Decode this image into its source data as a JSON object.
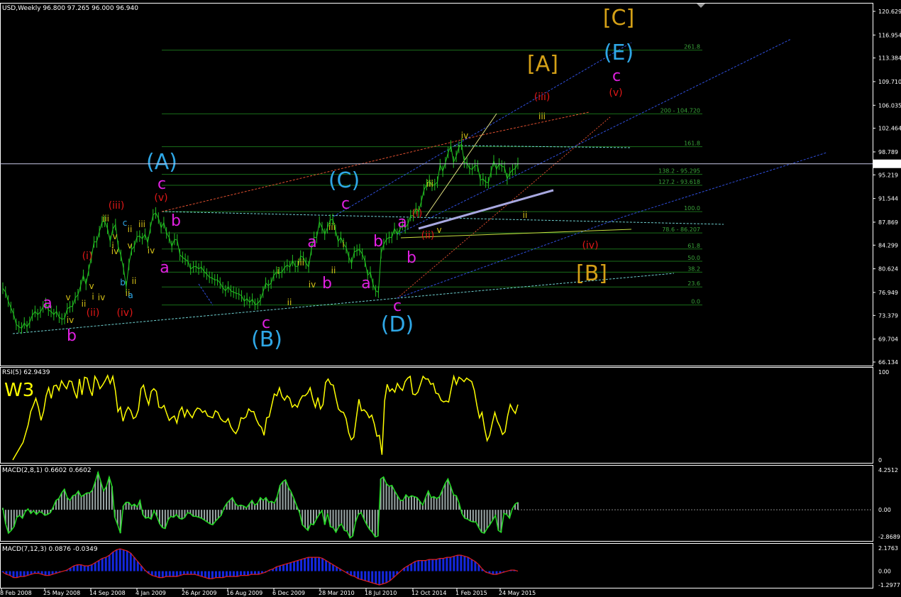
{
  "chart_data": {
    "type": "line",
    "symbol_title": "USD,Weekly  96.800 97.265 96.000 96.940",
    "current_price_label": "96.940",
    "y_ticks": [
      "120.629",
      "116.954",
      "113.384",
      "109.710",
      "106.035",
      "102.464",
      "98.789",
      "95.219",
      "91.544",
      "87.869",
      "84.299",
      "80.624",
      "76.949",
      "73.379",
      "69.704",
      "66.134"
    ],
    "x_ticks": [
      "8 Feb 2008",
      "25 May 2008",
      "14 Sep 2008",
      "4 Jan 2009",
      "26 Apr 2009",
      "16 Aug 2009",
      "6 Dec 2009",
      "28 Mar 2010",
      "18 Jul 2010",
      "12 Oct 2014",
      "1 Feb 2015",
      "24 May 2015"
    ],
    "price": [
      77.6,
      77.0,
      75.6,
      74.6,
      73.6,
      72.0,
      71.6,
      71.4,
      72.2,
      71.6,
      72.3,
      73.4,
      74.0,
      73.5,
      73.9,
      74.7,
      75.2,
      74.2,
      74.0,
      73.5,
      74.0,
      73.1,
      72.8,
      72.9,
      74.4,
      74.7,
      74.8,
      76.1,
      76.6,
      78.0,
      79.6,
      78.2,
      80.4,
      82.4,
      84.8,
      84.8,
      86.4,
      87.9,
      88.0,
      86.9,
      84.9,
      86.8,
      87.5,
      84.1,
      82.7,
      80.6,
      77.8,
      81.3,
      83.6,
      84.1,
      85.6,
      85.7,
      85.3,
      86.0,
      84.7,
      87.0,
      89.0,
      89.3,
      88.5,
      87.0,
      87.8,
      86.2,
      85.5,
      84.1,
      85.2,
      85.1,
      82.8,
      82.4,
      82.1,
      81.8,
      80.6,
      80.9,
      81.0,
      80.6,
      80.9,
      80.2,
      79.8,
      79.3,
      79.2,
      78.9,
      78.9,
      78.4,
      77.7,
      77.2,
      77.8,
      77.2,
      77.0,
      76.8,
      76.7,
      76.4,
      75.6,
      76.0,
      75.4,
      75.9,
      75.1,
      75.2,
      75.8,
      77.0,
      78.4,
      78.0,
      78.4,
      79.6,
      80.1,
      80.0,
      80.1,
      80.8,
      81.2,
      80.9,
      81.9,
      81.0,
      81.0,
      82.6,
      82.4,
      81.5,
      80.9,
      83.6,
      85.5,
      85.5,
      87.9,
      87.0,
      86.0,
      87.0,
      88.2,
      88.3,
      86.6,
      84.9,
      85.5,
      84.5,
      83.9,
      82.4,
      81.5,
      83.2,
      83.5,
      83.6,
      82.9,
      81.8,
      79.6,
      80.1,
      78.2,
      77.2,
      77.0,
      83.1,
      84.4,
      85.2,
      85.5,
      85.5,
      86.9,
      86.0,
      86.7,
      87.5,
      87.0,
      87.6,
      88.9,
      88.9,
      90.0,
      89.5,
      91.1,
      92.9,
      93.7,
      94.3,
      93.6,
      93.7,
      94.1,
      96.8,
      95.8,
      97.1,
      98.7,
      99.7,
      97.2,
      98.1,
      99.5,
      100.0,
      97.2,
      97.1,
      96.2,
      96.1,
      96.7,
      96.6,
      94.4,
      94.6,
      94.1,
      94.0,
      95.7,
      97.4,
      96.1,
      96.9,
      96.6,
      96.4,
      94.6,
      95.5,
      96.0,
      96.2,
      97.0
    ],
    "rsi": {
      "title": "RSI(5) 62.9439",
      "label": "W3",
      "y_ticks": [
        "100",
        "0"
      ],
      "values": [
        0,
        5,
        10,
        15,
        20,
        30,
        40,
        55,
        62,
        70,
        60,
        45,
        55,
        73,
        82,
        70,
        84,
        85,
        79,
        90,
        85,
        81,
        90,
        89,
        78,
        70,
        92,
        74,
        94,
        93,
        81,
        73,
        95,
        90,
        81,
        85,
        90,
        96,
        87,
        95,
        79,
        55,
        60,
        44,
        54,
        60,
        56,
        47,
        49,
        57,
        81,
        85,
        72,
        63,
        78,
        81,
        78,
        60,
        59,
        62,
        53,
        45,
        48,
        50,
        42,
        55,
        60,
        49,
        57,
        52,
        48,
        55,
        59,
        58,
        54,
        56,
        50,
        49,
        48,
        56,
        54,
        47,
        44,
        43,
        47,
        38,
        33,
        30,
        36,
        48,
        47,
        49,
        58,
        55,
        55,
        46,
        40,
        37,
        28,
        48,
        49,
        62,
        75,
        73,
        82,
        72,
        68,
        73,
        70,
        60,
        63,
        60,
        68,
        73,
        73,
        76,
        82,
        69,
        60,
        71,
        58,
        63,
        88,
        92,
        86,
        85,
        71,
        58,
        55,
        54,
        47,
        31,
        23,
        26,
        48,
        69,
        56,
        57,
        54,
        48,
        51,
        41,
        27,
        28,
        6,
        67,
        86,
        78,
        81,
        77,
        87,
        82,
        79,
        89,
        93,
        95,
        75,
        74,
        77,
        86,
        95,
        92,
        92,
        86,
        87,
        76,
        75,
        68,
        66,
        67,
        66,
        81,
        95,
        86,
        94,
        92,
        89,
        93,
        91,
        89,
        79,
        62,
        48,
        54,
        36,
        22,
        28,
        42,
        54,
        44,
        38,
        29,
        32,
        50,
        63,
        57,
        53,
        63
      ]
    },
    "macd1": {
      "title": "MACD(2,8,1) 0.6602 0.6602",
      "y_ticks": [
        "4.2512",
        "0.00",
        "-2.8689"
      ],
      "values": [
        0.2,
        -1.5,
        -2.5,
        -2.2,
        -1.8,
        -0.8,
        -0.6,
        -0.9,
        -0.2,
        0.1,
        -0.4,
        -0.1,
        -0.5,
        -0.2,
        -0.3,
        -0.6,
        -0.5,
        -0.3,
        0.3,
        1.0,
        1.2,
        1.8,
        2.2,
        1.3,
        1.0,
        1.5,
        1.6,
        2.0,
        1.4,
        1.6,
        1.8,
        1.8,
        2.1,
        3.0,
        4.0,
        3.0,
        2.0,
        2.5,
        3.5,
        2.5,
        -0.8,
        -1.6,
        -2.5,
        0.4,
        0.8,
        0.8,
        0.4,
        0.6,
        0.3,
        1.0,
        -0.5,
        -0.9,
        -0.8,
        -1.0,
        -0.1,
        -0.7,
        -1.5,
        -1.9,
        -2.0,
        -1.1,
        -0.7,
        -0.8,
        -0.5,
        -0.9,
        -1.0,
        -0.8,
        -0.3,
        -0.4,
        -0.7,
        -0.7,
        -0.8,
        -0.9,
        -1.1,
        -1.3,
        -1.5,
        -1.6,
        -1.2,
        -0.9,
        -0.6,
        0.2,
        0.7,
        1.0,
        1.3,
        0.7,
        0.4,
        0.5,
        0.4,
        0.2,
        0.6,
        1.0,
        0.5,
        0.7,
        1.3,
        1.0,
        1.3,
        0.8,
        0.9,
        0.7,
        1.4,
        2.6,
        3.0,
        3.2,
        2.4,
        1.9,
        1.2,
        0.4,
        -0.3,
        -1.6,
        -1.9,
        -2.2,
        -1.5,
        -1.6,
        -1.0,
        -0.5,
        -0.1,
        -1.6,
        -0.4,
        -1.8,
        -1.9,
        -2.4,
        -1.8,
        -1.5,
        -2.2,
        -2.3,
        -3.0,
        -2.8,
        -1.3,
        -0.5,
        -0.3,
        -1.0,
        -1.6,
        -2.1,
        -2.4,
        -2.9,
        -2.8,
        3.3,
        3.5,
        2.8,
        2.5,
        2.6,
        2.0,
        1.5,
        1.0,
        1.0,
        1.6,
        1.3,
        1.5,
        1.4,
        1.3,
        0.9,
        0.5,
        1.3,
        2.0,
        1.3,
        1.4,
        1.2,
        1.4,
        2.1,
        2.8,
        3.3,
        2.5,
        1.6,
        1.5,
        0.7,
        -0.4,
        -0.9,
        -1.0,
        -1.2,
        -1.3,
        -1.3,
        -1.9,
        -2.4,
        -2.5,
        -2.0,
        -1.6,
        -1.1,
        -0.6,
        -2.2,
        -2.4,
        -0.4,
        -0.5,
        -0.9,
        0.1,
        0.6,
        0.8
      ]
    },
    "macd2": {
      "title": "MACD(7,12,3) 0.0876 -0.0349",
      "y_ticks": [
        "2.1763",
        "0.00",
        "-1.2977"
      ],
      "values": [
        -0.1,
        -0.3,
        -0.4,
        -0.6,
        -0.6,
        -0.5,
        -0.5,
        -0.4,
        -0.3,
        -0.2,
        -0.2,
        -0.3,
        -0.4,
        -0.4,
        -0.3,
        -0.2,
        -0.1,
        0.0,
        0.1,
        0.3,
        0.5,
        0.6,
        0.6,
        0.5,
        0.5,
        0.6,
        0.8,
        1.0,
        1.2,
        1.3,
        1.5,
        1.8,
        2.0,
        2.1,
        2.0,
        1.9,
        1.7,
        1.3,
        0.9,
        0.5,
        0.1,
        -0.2,
        -0.4,
        -0.5,
        -0.6,
        -0.6,
        -0.5,
        -0.5,
        -0.5,
        -0.5,
        -0.4,
        -0.3,
        -0.3,
        -0.3,
        -0.3,
        -0.4,
        -0.5,
        -0.6,
        -0.7,
        -0.7,
        -0.6,
        -0.6,
        -0.6,
        -0.5,
        -0.5,
        -0.5,
        -0.5,
        -0.4,
        -0.4,
        -0.4,
        -0.3,
        -0.3,
        -0.3,
        -0.2,
        -0.1,
        0.1,
        0.2,
        0.4,
        0.5,
        0.6,
        0.7,
        0.8,
        0.9,
        1.0,
        1.1,
        1.2,
        1.3,
        1.3,
        1.3,
        1.3,
        1.2,
        1.0,
        0.8,
        0.6,
        0.4,
        0.2,
        0.0,
        -0.2,
        -0.4,
        -0.5,
        -0.7,
        -0.8,
        -0.9,
        -1.0,
        -1.1,
        -1.2,
        -1.3,
        -1.2,
        -1.1,
        -0.9,
        -0.6,
        -0.3,
        0.0,
        0.3,
        0.5,
        0.7,
        0.9,
        1.0,
        1.0,
        1.0,
        1.1,
        1.1,
        1.1,
        1.2,
        1.2,
        1.3,
        1.3,
        1.4,
        1.5,
        1.5,
        1.4,
        1.3,
        1.1,
        0.9,
        0.6,
        0.2,
        -0.1,
        -0.2,
        -0.3,
        -0.3,
        -0.2,
        -0.1,
        0.0,
        0.1,
        0.1,
        0.0
      ]
    }
  },
  "fib_labels": [
    {
      "text": "261.8",
      "price": 114.6
    },
    {
      "text": "200 - 104.720",
      "price": 104.7
    },
    {
      "text": "161.8",
      "price": 99.6
    },
    {
      "text": "138.2 - 95.295",
      "price": 95.3
    },
    {
      "text": "127.2 - 93.618",
      "price": 93.6
    },
    {
      "text": "100.0",
      "price": 89.5
    },
    {
      "text": "78.6 - 86.207",
      "price": 86.2
    },
    {
      "text": "61.8",
      "price": 83.7
    },
    {
      "text": "50.0",
      "price": 81.8
    },
    {
      "text": "38.2",
      "price": 80.1
    },
    {
      "text": "23.6",
      "price": 77.8
    },
    {
      "text": "0.0",
      "price": 75.0
    }
  ],
  "wave_labels": [
    {
      "t": "(A)",
      "c": "#2fa7e6",
      "s": 30
    },
    {
      "t": "(B)",
      "c": "#2fa7e6",
      "s": 30
    },
    {
      "t": "(C)",
      "c": "#2fa7e6",
      "s": 30
    },
    {
      "t": "(D)",
      "c": "#2fa7e6",
      "s": 30
    },
    {
      "t": "(E)",
      "c": "#2fa7e6",
      "s": 30
    },
    {
      "t": "[A]",
      "c": "#d4a017",
      "s": 30
    },
    {
      "t": "[B]",
      "c": "#d4a017",
      "s": 30
    },
    {
      "t": "[C]",
      "c": "#d4a017",
      "s": 30
    },
    {
      "t": "c",
      "c": "#e020e0",
      "s": 22
    },
    {
      "t": "c",
      "c": "#e020e0",
      "s": 22
    },
    {
      "t": "c",
      "c": "#e020e0",
      "s": 22
    },
    {
      "t": "c",
      "c": "#e020e0",
      "s": 22
    },
    {
      "t": "c",
      "c": "#e020e0",
      "s": 22
    },
    {
      "t": "a",
      "c": "#e020e0",
      "s": 22
    },
    {
      "t": "a",
      "c": "#e020e0",
      "s": 22
    },
    {
      "t": "a",
      "c": "#e020e0",
      "s": 22
    },
    {
      "t": "a",
      "c": "#e020e0",
      "s": 22
    },
    {
      "t": "a",
      "c": "#e020e0",
      "s": 22
    },
    {
      "t": "a",
      "c": "#e020e0",
      "s": 22
    },
    {
      "t": "b",
      "c": "#e020e0",
      "s": 22
    },
    {
      "t": "b",
      "c": "#e020e0",
      "s": 22
    },
    {
      "t": "b",
      "c": "#e020e0",
      "s": 22
    },
    {
      "t": "b",
      "c": "#e020e0",
      "s": 22
    },
    {
      "t": "b",
      "c": "#e020e0",
      "s": 22
    },
    {
      "t": "(v)",
      "c": "#e01818",
      "s": 14
    },
    {
      "t": "(iii)",
      "c": "#e01818",
      "s": 14
    },
    {
      "t": "(i)",
      "c": "#e01818",
      "s": 14
    },
    {
      "t": "(ii)",
      "c": "#e01818",
      "s": 14
    },
    {
      "t": "(iv)",
      "c": "#e01818",
      "s": 14
    },
    {
      "t": "(iii)",
      "c": "#e01818",
      "s": 14
    },
    {
      "t": "(v)",
      "c": "#e01818",
      "s": 14
    },
    {
      "t": "(iv)",
      "c": "#e01818",
      "s": 14
    },
    {
      "t": "(i)",
      "c": "#e01818",
      "s": 14
    },
    {
      "t": "(ii)",
      "c": "#e01818",
      "s": 14
    },
    {
      "t": "iii",
      "c": "#d4c017",
      "s": 12
    },
    {
      "t": "v",
      "c": "#d4c017",
      "s": 12
    },
    {
      "t": "iv",
      "c": "#d4c017",
      "s": 12
    },
    {
      "t": "i",
      "c": "#d4c017",
      "s": 12
    },
    {
      "t": "ii",
      "c": "#d4c017",
      "s": 12
    },
    {
      "t": "iii",
      "c": "#d4c017",
      "s": 12
    },
    {
      "t": "v",
      "c": "#d4c017",
      "s": 12
    },
    {
      "t": "iv",
      "c": "#d4c017",
      "s": 12
    },
    {
      "t": "ii",
      "c": "#d4c017",
      "s": 12
    },
    {
      "t": "iii",
      "c": "#d4c017",
      "s": 12
    },
    {
      "t": "i",
      "c": "#d4c017",
      "s": 12
    },
    {
      "t": "iv",
      "c": "#d4c017",
      "s": 12
    },
    {
      "t": "ii",
      "c": "#d4c017",
      "s": 12
    },
    {
      "t": "ii",
      "c": "#d4c017",
      "s": 12
    },
    {
      "t": "iii",
      "c": "#d4c017",
      "s": 12
    },
    {
      "t": "i",
      "c": "#d4c017",
      "s": 12
    },
    {
      "t": "iv",
      "c": "#d4c017",
      "s": 12
    },
    {
      "t": "ii",
      "c": "#d4c017",
      "s": 12
    },
    {
      "t": "v",
      "c": "#d4c017",
      "s": 12
    },
    {
      "t": "i",
      "c": "#d4c017",
      "s": 12
    },
    {
      "t": "ii",
      "c": "#d4c017",
      "s": 12
    },
    {
      "t": "iii",
      "c": "#d4c017",
      "s": 12
    },
    {
      "t": "v",
      "c": "#d4c017",
      "s": 12
    },
    {
      "t": "iv",
      "c": "#d4c017",
      "s": 12
    },
    {
      "t": "iii",
      "c": "#d4c017",
      "s": 12
    },
    {
      "t": "ii",
      "c": "#d4c017",
      "s": 12
    },
    {
      "t": "v",
      "c": "#d4c017",
      "s": 12
    },
    {
      "t": "iv",
      "c": "#d4c017",
      "s": 12
    },
    {
      "t": "b",
      "c": "#2fa7e6",
      "s": 12
    },
    {
      "t": "a",
      "c": "#2fa7e6",
      "s": 12
    },
    {
      "t": "c",
      "c": "#2fa7e6",
      "s": 12
    }
  ],
  "colors": {
    "price": "#22c022",
    "rsi": "#ffff00",
    "macd_signal": "#22dd22",
    "macd_hist": "#9aa6a6",
    "macd2_signal": "#e02020",
    "macd2_hist": "#1428e0",
    "fib": "#1a6e1a",
    "panel_border": "#ffffff"
  },
  "scroll_icon": "scroll-marker-icon"
}
